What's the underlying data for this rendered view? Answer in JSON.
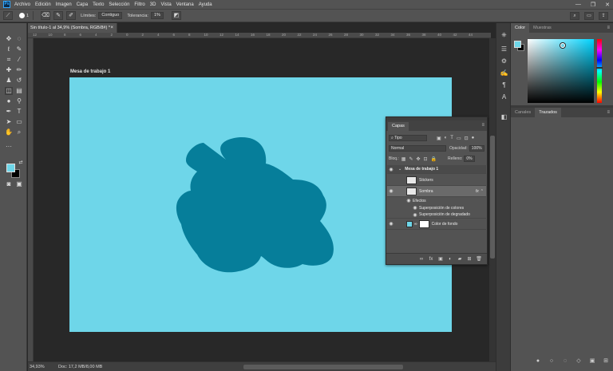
{
  "app": {
    "logo": "Ps"
  },
  "menu": [
    "Archivo",
    "Edición",
    "Imagen",
    "Capa",
    "Texto",
    "Selección",
    "Filtro",
    "3D",
    "Vista",
    "Ventana",
    "Ayuda"
  ],
  "window_controls": {
    "minimize": "—",
    "restore": "❐",
    "close": "✕"
  },
  "options": {
    "brush_size": "1",
    "limits_label": "Límites:",
    "limits_value": "Contiguo",
    "tolerance_label": "Tolerancia:",
    "tolerance_value": "1%"
  },
  "document": {
    "tab_title": "Sin título-1 al 34,9% (Sombra, RGB/8#) *",
    "close": "×",
    "artboard_label": "Mesa de trabajo 1",
    "artboard_color": "#6ed6e9",
    "shape_color": "#067e9a"
  },
  "ruler_ticks": [
    "12",
    "10",
    "8",
    "6",
    "4",
    "2",
    "0",
    "2",
    "4",
    "6",
    "8",
    "10",
    "12",
    "14",
    "16",
    "18",
    "20",
    "22",
    "24",
    "26",
    "28",
    "30",
    "32",
    "34",
    "36",
    "38",
    "40",
    "42",
    "44"
  ],
  "status": {
    "zoom": "34,93%",
    "doc_info": "Doc: 17,2 MB/8,00 MB"
  },
  "color_panel": {
    "tab_color": "Color",
    "tab_swatches": "Muestras"
  },
  "paths_panel": {
    "tab_channels": "Canales",
    "tab_paths": "Trazados"
  },
  "layers_panel": {
    "tab": "Capas",
    "filter": "Tipo",
    "blend_mode": "Normal",
    "opacity_label": "Opacidad:",
    "opacity_value": "100%",
    "lock_label": "Bloq.:",
    "fill_label": "Relleno:",
    "fill_value": "0%",
    "layers": {
      "artboard": "Mesa de trabajo 1",
      "stickers": "Stickers",
      "sombra": "Sombra",
      "fx": "fx",
      "effects": "Efectos",
      "effect_1": "Superposición de colores",
      "effect_2": "Superposición de degradado",
      "background": "Color de fondo"
    }
  }
}
